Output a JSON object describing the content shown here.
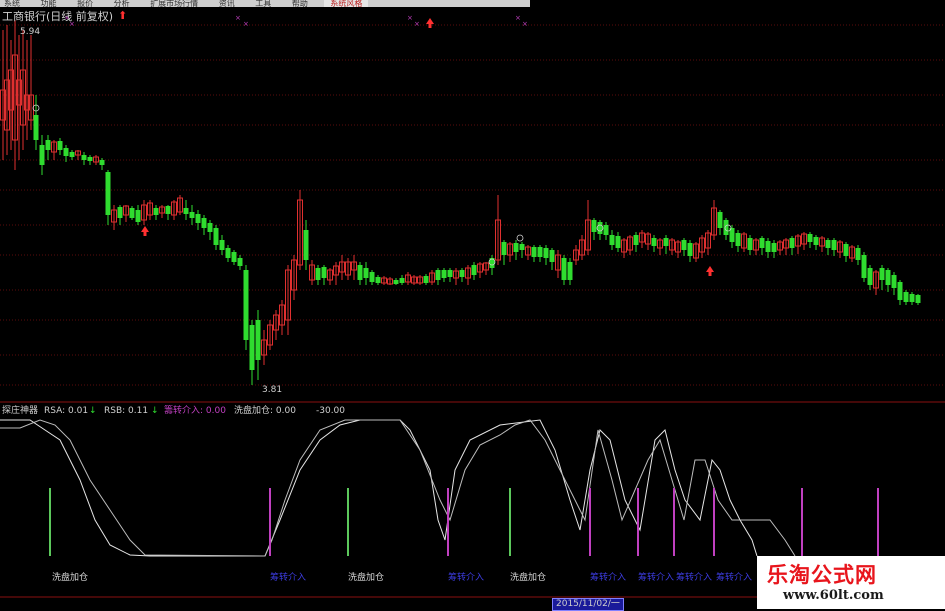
{
  "menubar": {
    "items": [
      "系统",
      "功能",
      "报价",
      "分析",
      "扩展市场行情",
      "资讯",
      "工具",
      "帮助"
    ],
    "highlight": "系统风格"
  },
  "main_chart": {
    "title": "工商银行(日线 前复权)",
    "high_label": "5.94",
    "low_label": "3.81"
  },
  "indicator": {
    "name": "探庄神器",
    "rsa_label": "RSA: 0.01",
    "rsb_label": "RSB: 0.11",
    "arrow": "↓",
    "zhuli_label": "籌转介入: 0.00",
    "xipan_label": "洗盘加仓: 0.00",
    "extra_label": "-30.00",
    "bar_labels": [
      {
        "text": "洗盘加仓",
        "kind": "xipan"
      },
      {
        "text": "筹转介入",
        "kind": "zhuli"
      },
      {
        "text": "洗盘加仓",
        "kind": "xipan"
      },
      {
        "text": "筹转介入",
        "kind": "zhuli"
      },
      {
        "text": "洗盘加仓",
        "kind": "xipan"
      },
      {
        "text": "筹转介入",
        "kind": "zhuli"
      },
      {
        "text": "筹转介入",
        "kind": "zhuli"
      },
      {
        "text": "筹转介入",
        "kind": "zhuli"
      },
      {
        "text": "筹转介入",
        "kind": "zhuli"
      }
    ]
  },
  "bottom_date": "2015/11/02/一",
  "watermark": {
    "logo": "乐淘公式网",
    "url": "www.60lt.com"
  },
  "colors": {
    "up": "#e03030",
    "down": "#2fdc2f",
    "xipan": "#5cc85c",
    "zhuli": "#c040c0",
    "grid": "#7a1010",
    "label_blue": "#3c3ce0"
  }
}
